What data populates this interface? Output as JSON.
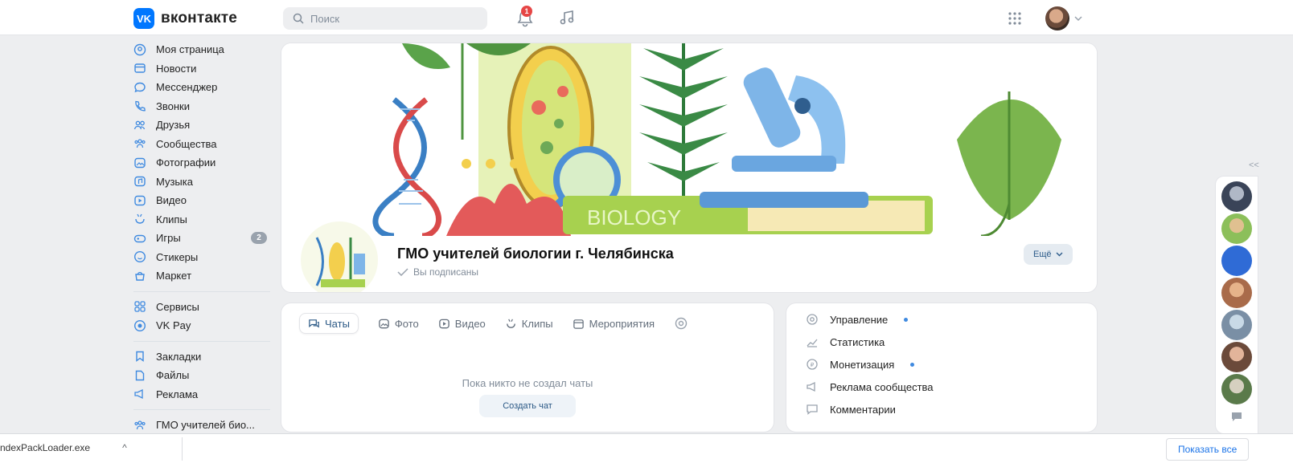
{
  "header": {
    "logo_mark": "VK",
    "logo_text": "вконтакте",
    "search_placeholder": "Поиск",
    "notification_count": "1"
  },
  "sidebar": {
    "items": [
      {
        "label": "Моя страница",
        "icon": "user-circle-icon"
      },
      {
        "label": "Новости",
        "icon": "news-icon"
      },
      {
        "label": "Мессенджер",
        "icon": "message-icon"
      },
      {
        "label": "Звонки",
        "icon": "phone-icon"
      },
      {
        "label": "Друзья",
        "icon": "friends-icon"
      },
      {
        "label": "Сообщества",
        "icon": "communities-icon"
      },
      {
        "label": "Фотографии",
        "icon": "photo-icon"
      },
      {
        "label": "Музыка",
        "icon": "music-icon"
      },
      {
        "label": "Видео",
        "icon": "video-icon"
      },
      {
        "label": "Клипы",
        "icon": "clips-icon"
      },
      {
        "label": "Игры",
        "icon": "gamepad-icon",
        "badge": "2"
      },
      {
        "label": "Стикеры",
        "icon": "smile-icon"
      },
      {
        "label": "Маркет",
        "icon": "market-icon"
      }
    ],
    "items2": [
      {
        "label": "Сервисы",
        "icon": "services-icon"
      },
      {
        "label": "VK Pay",
        "icon": "vkpay-icon"
      }
    ],
    "items3": [
      {
        "label": "Закладки",
        "icon": "bookmark-icon"
      },
      {
        "label": "Файлы",
        "icon": "file-icon"
      },
      {
        "label": "Реклама",
        "icon": "ads-icon"
      }
    ],
    "items4": [
      {
        "label": "ГМО учителей био...",
        "icon": "communities-icon"
      }
    ]
  },
  "group": {
    "cover_text": "BIOLOGY",
    "name": "ГМО учителей биологии г. Челябинска",
    "subscribed": "Вы подписаны",
    "more_label": "Ещё"
  },
  "tabs": {
    "items": [
      {
        "label": "Чаты",
        "icon": "chat-icon"
      },
      {
        "label": "Фото",
        "icon": "photo-icon"
      },
      {
        "label": "Видео",
        "icon": "video-icon"
      },
      {
        "label": "Клипы",
        "icon": "clips-icon"
      },
      {
        "label": "Мероприятия",
        "icon": "calendar-icon"
      }
    ],
    "empty_text": "Пока никто не создал чаты",
    "create_label": "Создать чат"
  },
  "admin": {
    "items": [
      {
        "label": "Управление",
        "dot": true
      },
      {
        "label": "Статистика",
        "dot": false
      },
      {
        "label": "Монетизация",
        "dot": true
      },
      {
        "label": "Реклама сообщества",
        "dot": false
      },
      {
        "label": "Комментарии",
        "dot": false
      }
    ]
  },
  "chatbar": {
    "collapse": "<<"
  },
  "download_bar": {
    "file_name": "ndexPackLoader.exe",
    "chevron": "^",
    "show_all": "Показать все"
  },
  "colors": {
    "accent": "#0077ff",
    "link": "#2a5885",
    "badge_red": "#e64646"
  }
}
